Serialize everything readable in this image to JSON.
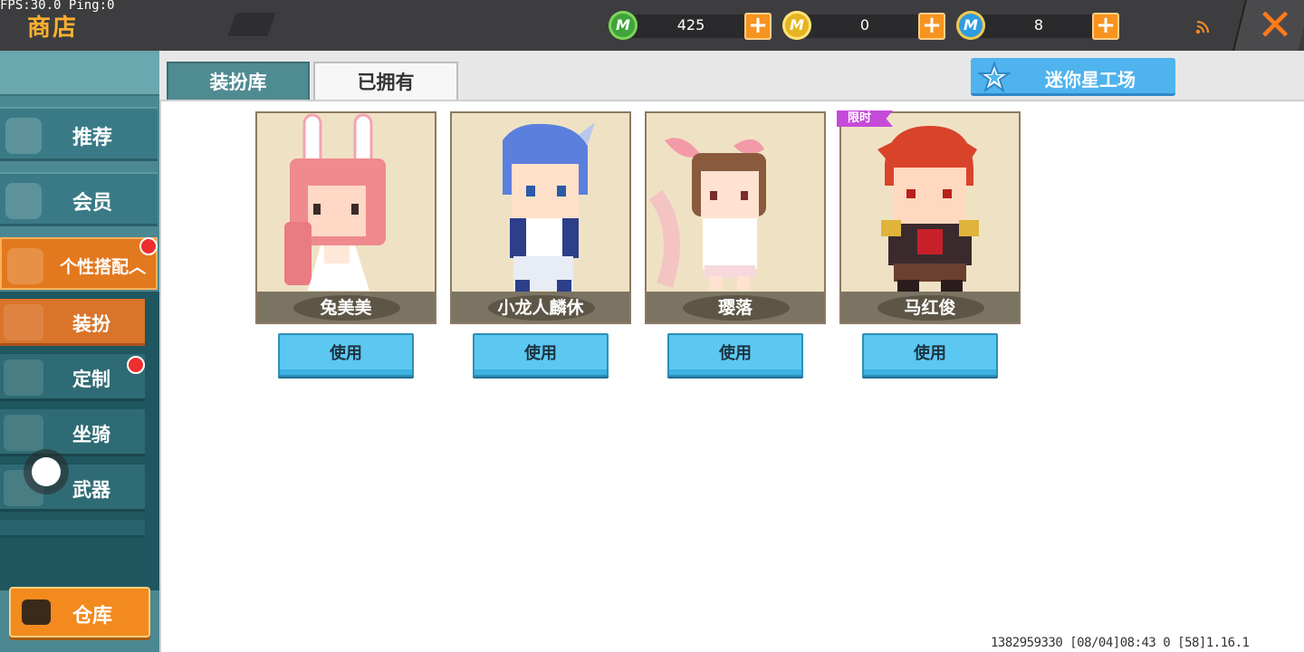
{
  "debug": {
    "fps_text": "FPS:30.0  Ping:0"
  },
  "header": {
    "title": "商店"
  },
  "currencies": [
    {
      "icon": "green-gem-icon",
      "value": "425",
      "color": "#3fa53a"
    },
    {
      "icon": "gold-coin-icon",
      "value": "0",
      "color": "#e6b422"
    },
    {
      "icon": "blue-coin-icon",
      "value": "8",
      "color": "#2f9be0"
    }
  ],
  "sidebar": {
    "items": [
      {
        "label": "推荐"
      },
      {
        "label": "会员"
      },
      {
        "label": "个性搭配︿"
      }
    ],
    "sub_items": [
      {
        "label": "装扮"
      },
      {
        "label": "定制"
      },
      {
        "label": "坐骑"
      },
      {
        "label": "武器"
      }
    ],
    "warehouse_label": "仓库"
  },
  "tabs": [
    {
      "label": "装扮库"
    },
    {
      "label": "已拥有"
    }
  ],
  "workshop_label": "迷你星工场",
  "limited_badge": "限时",
  "cards": [
    {
      "name": "兔美美",
      "button": "使用"
    },
    {
      "name": "小龙人麟休",
      "button": "使用"
    },
    {
      "name": "璎落",
      "button": "使用"
    },
    {
      "name": "马红俊",
      "button": "使用"
    }
  ],
  "footer_info": "1382959330  [08/04]08:43 0  [58]1.16.1"
}
